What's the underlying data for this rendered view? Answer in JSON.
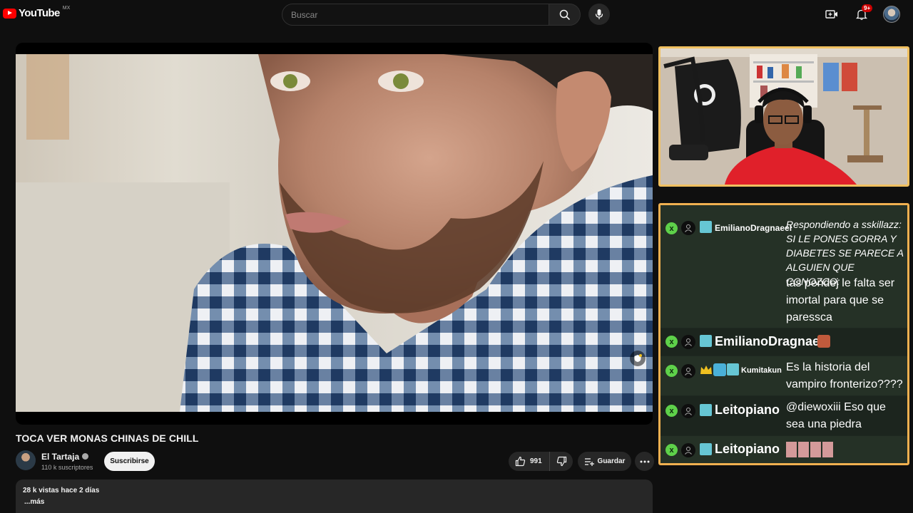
{
  "header": {
    "logo_text": "YouTube",
    "region": "MX",
    "search_placeholder": "Buscar",
    "notifications_badge": "9+"
  },
  "video": {
    "title": "TOCA VER MONAS CHINAS DE CHILL",
    "channel": "El Tartaja",
    "subscribers": "110 k suscriptores",
    "subscribe_label": "Suscribirse",
    "likes": "991",
    "save_label": "Guardar",
    "views_date": "28 k vistas  hace 2 días",
    "more_label": "...más"
  },
  "chat": {
    "messages": [
      {
        "user": "EmilianoDragnaeel",
        "text": "Respondiendo a sskillazz: SI LE PONES GORRA Y DIABETES SE PARECE A ALGUIEN QUE CONOZCO:",
        "reply": "tas pendej le falta ser imortal para que se paressca"
      },
      {
        "user": "EmilianoDragnaeel",
        "text": ""
      },
      {
        "user": "Kumitakun",
        "text": "Es la historia del vampiro fronterizo????"
      },
      {
        "user": "Leitopiano",
        "text": "@diewoxiii Eso que sea una piedra"
      },
      {
        "user": "Leitopiano",
        "text": ""
      }
    ]
  },
  "colors": {
    "accent_red": "#ff0000",
    "webcam_border": "#f0c060",
    "chat_border": "#f0b050",
    "mod_badge": "#5ed14a"
  }
}
